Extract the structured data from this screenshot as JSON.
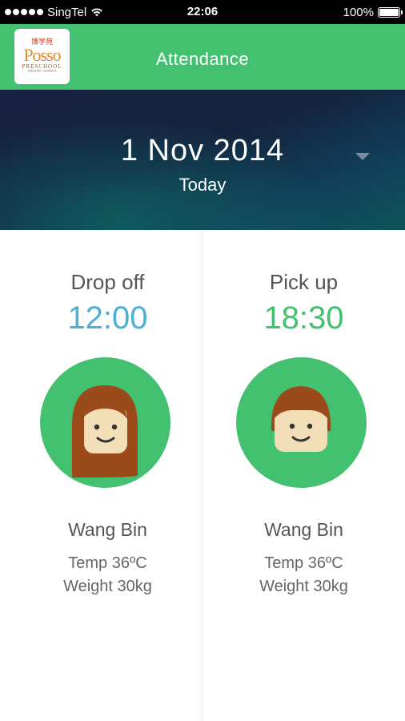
{
  "status_bar": {
    "carrier": "SingTel",
    "time": "22:06",
    "battery": "100%",
    "battery_level": 1.0,
    "signal_bars": 5
  },
  "header": {
    "title": "Attendance",
    "logo": {
      "chinese": "博学苑",
      "name": "Posso",
      "sub": "PRESCHOOL",
      "tagline": "rekindle intellect"
    }
  },
  "date_banner": {
    "date": "1 Nov 2014",
    "label": "Today"
  },
  "drop_off": {
    "title": "Drop off",
    "time": "12:00",
    "name": "Wang Bin",
    "temp": "Temp 36ºC",
    "weight": "Weight 30kg"
  },
  "pick_up": {
    "title": "Pick up",
    "time": "18:30",
    "name": "Wang Bin",
    "temp": "Temp 36ºC",
    "weight": "Weight 30kg"
  },
  "colors": {
    "brand_green": "#43c070",
    "time_blue": "#4ab0d6",
    "banner_dark": "#16223f"
  }
}
